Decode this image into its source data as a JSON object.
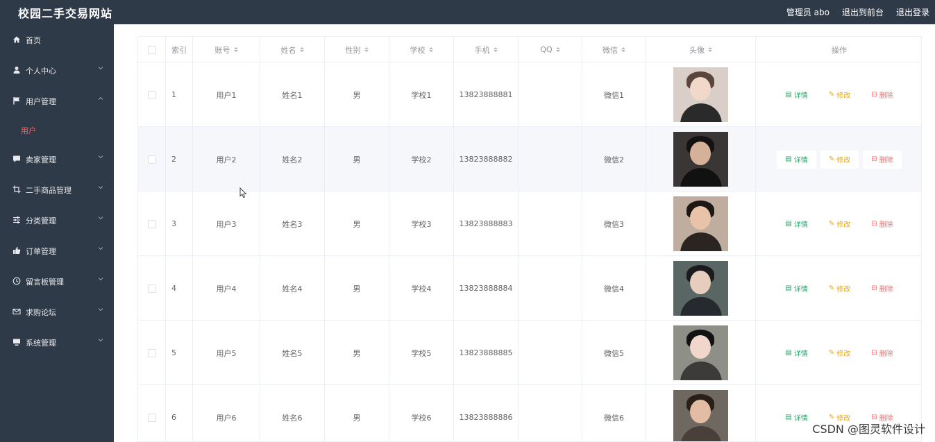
{
  "header": {
    "title": "校园二手交易网站",
    "admin_label": "管理员 abo",
    "to_front": "退出到前台",
    "logout": "退出登录"
  },
  "sidebar": {
    "items": [
      {
        "label": "首页",
        "icon": "home-icon",
        "arrow": "none"
      },
      {
        "label": "个人中心",
        "icon": "user-icon",
        "arrow": "down"
      },
      {
        "label": "用户管理",
        "icon": "flag-icon",
        "arrow": "up"
      },
      {
        "label": "卖家管理",
        "icon": "chat-icon",
        "arrow": "down"
      },
      {
        "label": "二手商品管理",
        "icon": "crop-icon",
        "arrow": "down"
      },
      {
        "label": "分类管理",
        "icon": "sliders-icon",
        "arrow": "down"
      },
      {
        "label": "订单管理",
        "icon": "thumb-icon",
        "arrow": "down"
      },
      {
        "label": "留言板管理",
        "icon": "clock-icon",
        "arrow": "down"
      },
      {
        "label": "求购论坛",
        "icon": "mail-icon",
        "arrow": "down"
      },
      {
        "label": "系统管理",
        "icon": "monitor-icon",
        "arrow": "down"
      }
    ],
    "active_sub": "用户"
  },
  "table": {
    "columns": [
      "索引",
      "账号",
      "姓名",
      "性别",
      "学校",
      "手机",
      "QQ",
      "微信",
      "头像",
      "操作"
    ],
    "rows": [
      {
        "index": "1",
        "account": "用户1",
        "name": "姓名1",
        "gender": "男",
        "school": "学校1",
        "phone": "13823888881",
        "qq": "",
        "wechat": "微信1"
      },
      {
        "index": "2",
        "account": "用户2",
        "name": "姓名2",
        "gender": "男",
        "school": "学校2",
        "phone": "13823888882",
        "qq": "",
        "wechat": "微信2"
      },
      {
        "index": "3",
        "account": "用户3",
        "name": "姓名3",
        "gender": "男",
        "school": "学校3",
        "phone": "13823888883",
        "qq": "",
        "wechat": "微信3"
      },
      {
        "index": "4",
        "account": "用户4",
        "name": "姓名4",
        "gender": "男",
        "school": "学校4",
        "phone": "13823888884",
        "qq": "",
        "wechat": "微信4"
      },
      {
        "index": "5",
        "account": "用户5",
        "name": "姓名5",
        "gender": "男",
        "school": "学校5",
        "phone": "13823888885",
        "qq": "",
        "wechat": "微信5"
      },
      {
        "index": "6",
        "account": "用户6",
        "name": "姓名6",
        "gender": "男",
        "school": "学校6",
        "phone": "13823888886",
        "qq": "",
        "wechat": "微信6"
      }
    ],
    "actions": {
      "detail": "详情",
      "edit": "修改",
      "delete": "删除"
    }
  },
  "colors": {
    "sidebar_bg": "#2f3a48",
    "active_sub": "#ff5a5a",
    "detail": "#2fa36b",
    "edit": "#e6a817",
    "delete": "#f56c6c"
  },
  "watermark": "CSDN @图灵软件设计"
}
